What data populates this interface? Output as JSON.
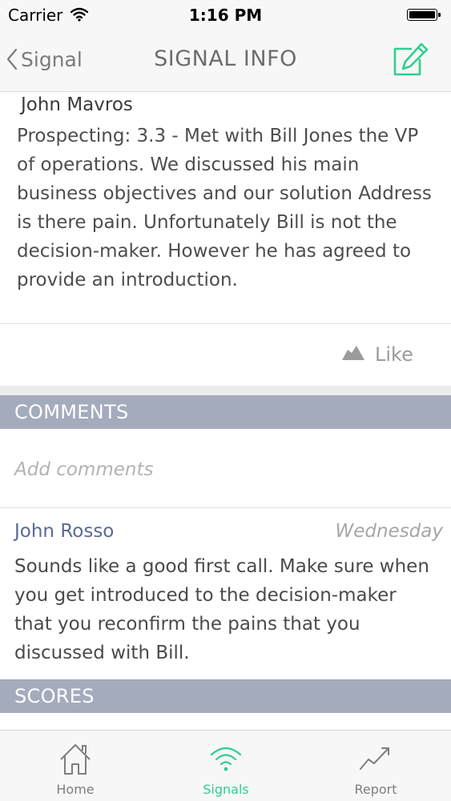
{
  "status_bar": {
    "carrier": "Carrier",
    "time": "1:16 PM"
  },
  "nav": {
    "back_label": "Signal",
    "title": "SIGNAL INFO"
  },
  "post": {
    "author": "John Mavros",
    "body": "Prospecting: 3.3 - Met with Bill Jones the VP of operations. We discussed his main business objectives and our solution Address is there pain. Unfortunately Bill is not the decision-maker. However he has agreed to provide an introduction.",
    "like_label": "Like"
  },
  "comments": {
    "header": "COMMENTS",
    "placeholder": "Add comments",
    "items": [
      {
        "author": "John Rosso",
        "day": "Wednesday",
        "text": "Sounds like a good first call. Make sure when you get introduced to the decision-maker that you reconfirm the pains that you discussed with Bill."
      }
    ]
  },
  "scores": {
    "header": "SCORES"
  },
  "tabs": [
    {
      "label": "Home",
      "icon": "home-icon",
      "active": false
    },
    {
      "label": "Signals",
      "icon": "wifi-signal-icon",
      "active": true
    },
    {
      "label": "Report",
      "icon": "trend-chart-icon",
      "active": false
    }
  ],
  "colors": {
    "accent": "#2fcf8e",
    "section_header": "#a4abbd",
    "commenter": "#5b6a92"
  }
}
